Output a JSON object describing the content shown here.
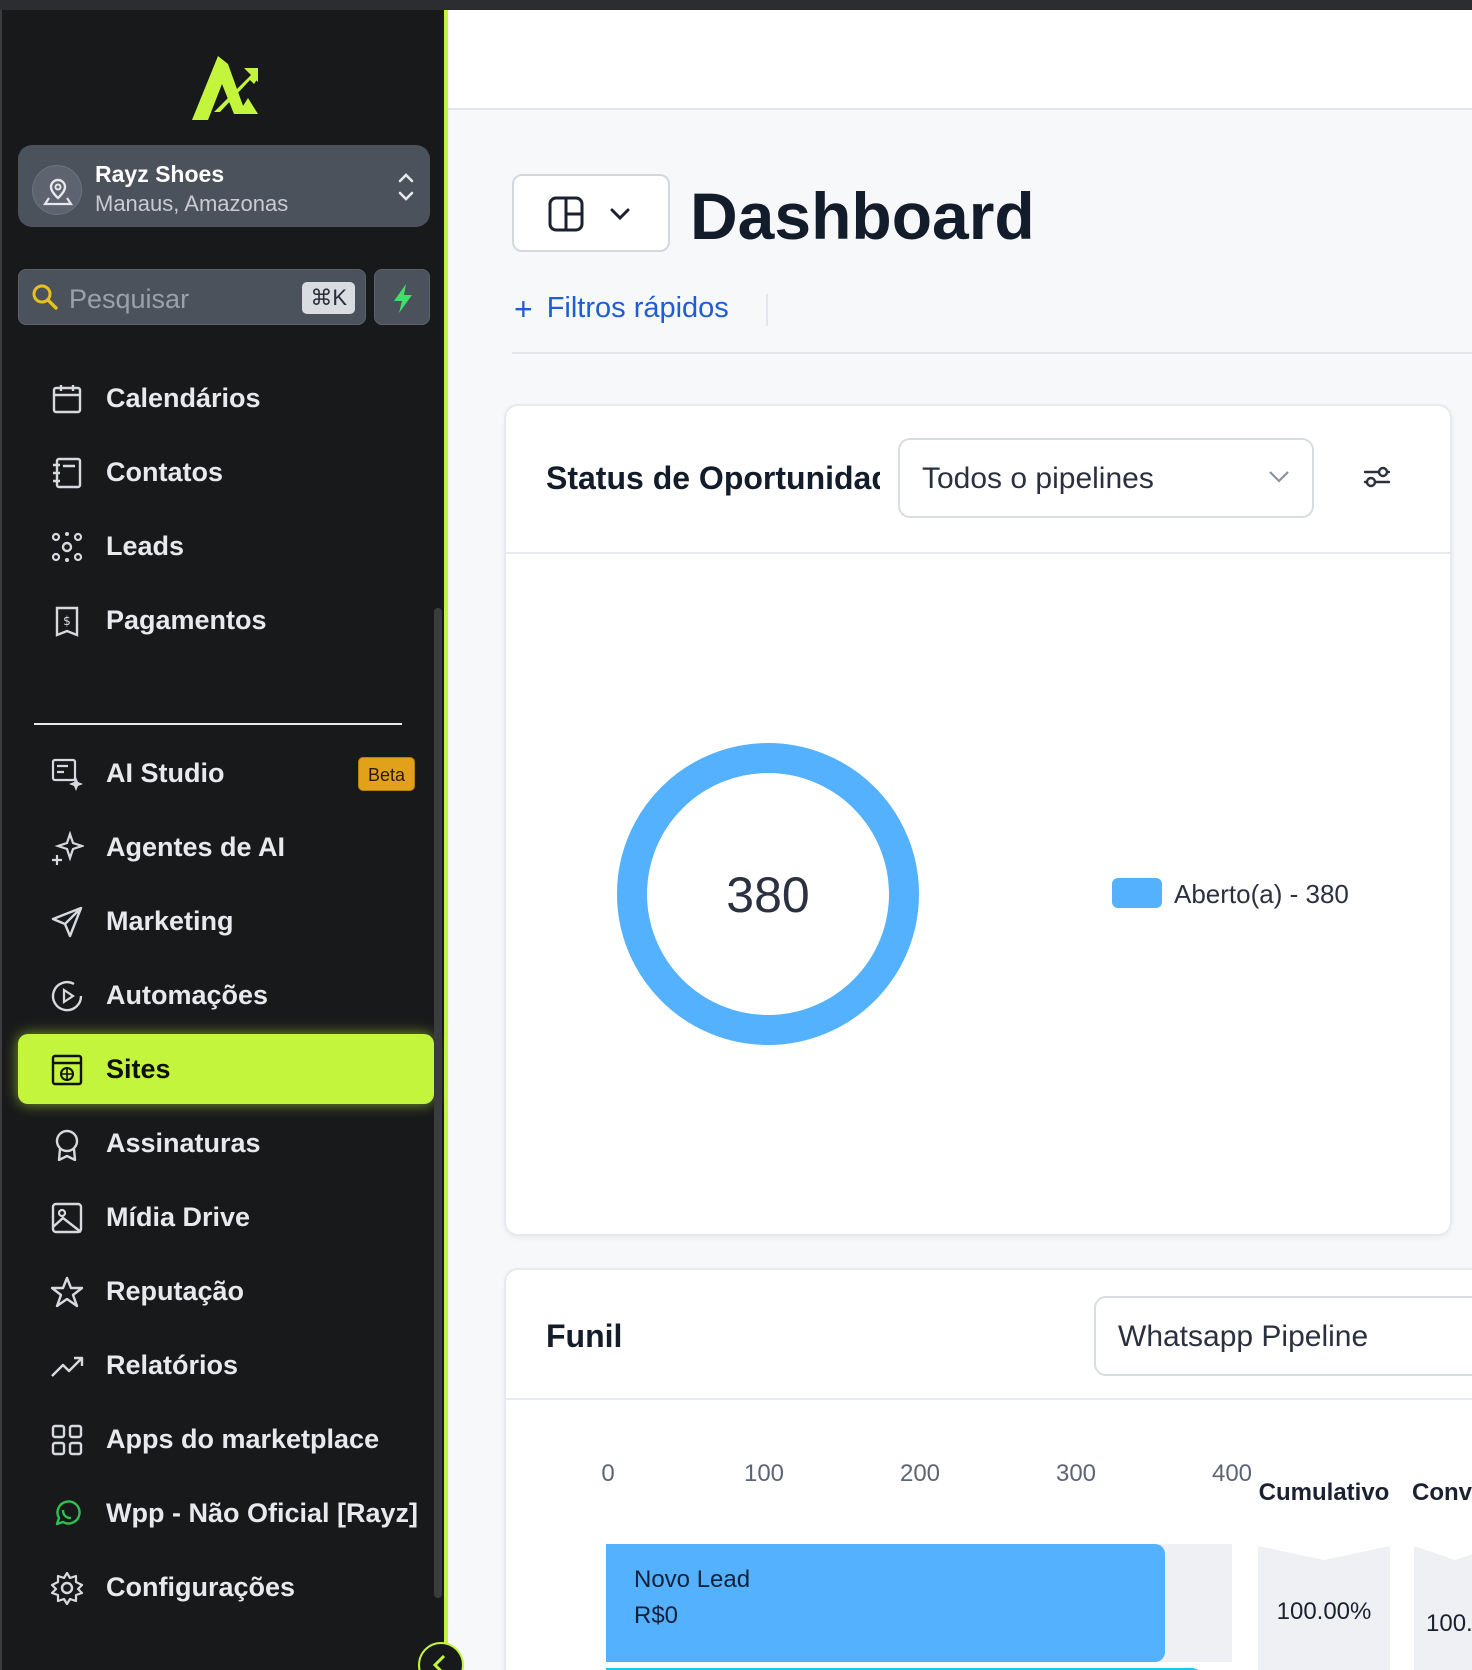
{
  "location": {
    "name": "Rayz Shoes",
    "sub": "Manaus, Amazonas"
  },
  "search": {
    "placeholder": "Pesquisar",
    "shortcut": "⌘K"
  },
  "nav": [
    {
      "label": "Calendários",
      "icon": "calendar-icon"
    },
    {
      "label": "Contatos",
      "icon": "contacts-icon"
    },
    {
      "label": "Leads",
      "icon": "leads-icon"
    },
    {
      "label": "Pagamentos",
      "icon": "payments-icon"
    },
    {
      "label": "AI Studio",
      "icon": "ai-studio-icon",
      "badge": "Beta"
    },
    {
      "label": "Agentes de AI",
      "icon": "sparkles-icon"
    },
    {
      "label": "Marketing",
      "icon": "send-icon"
    },
    {
      "label": "Automações",
      "icon": "automation-icon"
    },
    {
      "label": "Sites",
      "icon": "sites-icon",
      "active": true
    },
    {
      "label": "Assinaturas",
      "icon": "badge-icon"
    },
    {
      "label": "Mídia Drive",
      "icon": "image-icon"
    },
    {
      "label": "Reputação",
      "icon": "star-icon"
    },
    {
      "label": "Relatórios",
      "icon": "trending-icon"
    },
    {
      "label": "Apps do marketplace",
      "icon": "grid-icon"
    },
    {
      "label": "Wpp - Não Oficial [Rayz]",
      "icon": "whatsapp-icon"
    },
    {
      "label": "Configurações",
      "icon": "gear-icon"
    }
  ],
  "header": {
    "title": "Dashboard",
    "filters_label": "Filtros rápidos"
  },
  "status_card": {
    "title": "Status de Oportunidades",
    "select_value": "Todos o pipelines",
    "total": "380",
    "legend": "Aberto(a) - 380"
  },
  "funnel_card": {
    "title": "Funil",
    "select_value": "Whatsapp Pipeline",
    "ticks": [
      "0",
      "100",
      "200",
      "300",
      "400"
    ],
    "col_cumulative": "Cumulativo",
    "col_conversion": "Conv da pr eta",
    "stage_name": "Novo Lead",
    "stage_value": "R$0",
    "cumulative_value": "100.00%",
    "conversion_value": "100."
  },
  "chart_data": [
    {
      "type": "pie",
      "title": "Status de Oportunidades",
      "labels": [
        "Aberto(a)"
      ],
      "values": [
        380
      ],
      "center_label": "380"
    },
    {
      "type": "bar",
      "title": "Funil",
      "orientation": "horizontal",
      "categories": [
        "Novo Lead"
      ],
      "values": [
        380
      ],
      "xlim": [
        0,
        400
      ],
      "cumulative": [
        "100.00%"
      ]
    }
  ],
  "colors": {
    "accent": "#c3f53c",
    "sidebar": "#18191b",
    "link": "#1f5dd4",
    "series": "#53b1fd",
    "beta": "#e1a21a"
  }
}
